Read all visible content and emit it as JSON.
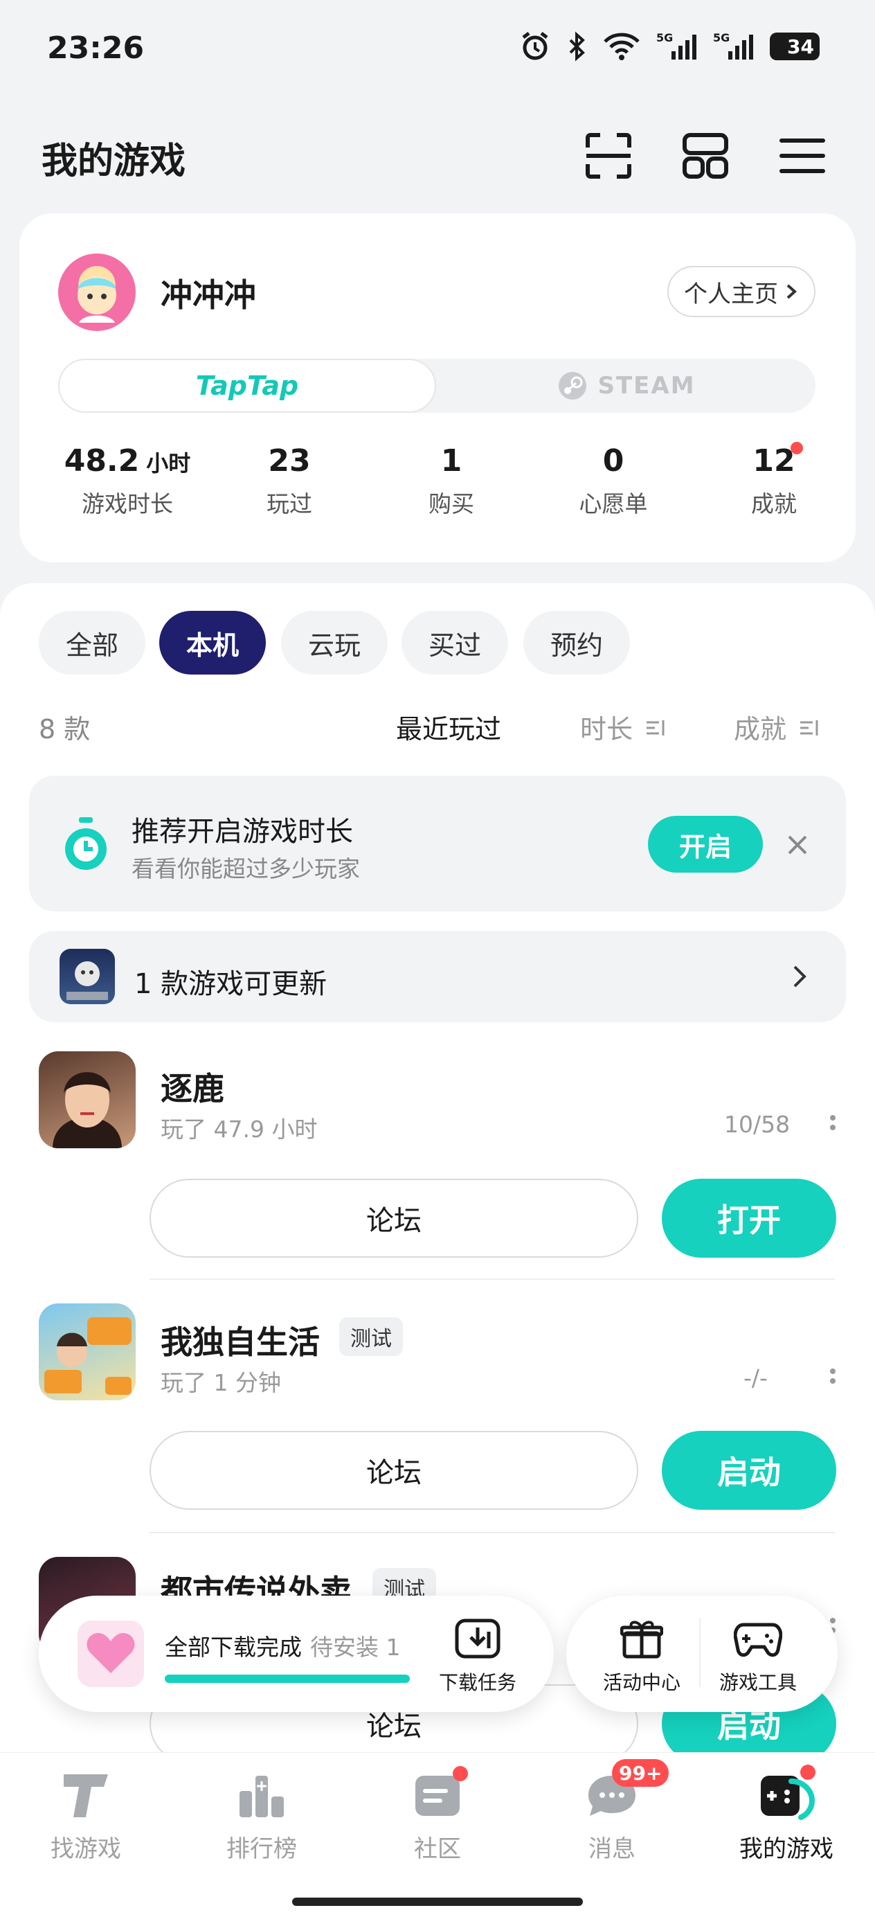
{
  "status_bar": {
    "time": "23:26",
    "battery": "34"
  },
  "header": {
    "title": "我的游戏"
  },
  "profile": {
    "name": "冲冲冲",
    "home_button": "个人主页",
    "segment_left": "TapTap",
    "segment_right": "STEAM",
    "stats": [
      {
        "value": "48.2",
        "unit": "小时",
        "label": "游戏时长"
      },
      {
        "value": "23",
        "label": "玩过"
      },
      {
        "value": "1",
        "label": "购买"
      },
      {
        "value": "0",
        "label": "心愿单"
      },
      {
        "value": "12",
        "label": "成就"
      }
    ]
  },
  "filters": {
    "chips": [
      "全部",
      "本机",
      "云玩",
      "买过",
      "预约"
    ],
    "active": "本机"
  },
  "sort": {
    "count": "8 款",
    "recent": "最近玩过",
    "duration": "时长",
    "achievement": "成就"
  },
  "recommend": {
    "title": "推荐开启游戏时长",
    "subtitle": "看看你能超过多少玩家",
    "button": "开启"
  },
  "update_bar": {
    "text": "1 款游戏可更新"
  },
  "games": [
    {
      "name": "逐鹿",
      "badge": "",
      "played": "玩了 47.9 小时",
      "progress": "10/58",
      "forum": "论坛",
      "action": "打开"
    },
    {
      "name": "我独自生活",
      "badge": "测试",
      "played": "玩了 1 分钟",
      "progress": "-/-",
      "forum": "论坛",
      "action": "启动"
    },
    {
      "name": "都市传说外卖",
      "badge": "测试",
      "played": "",
      "progress": "",
      "forum": "论坛",
      "action": "启动"
    }
  ],
  "download_bar": {
    "title": "全部下载完成",
    "pending": "待安装 1",
    "task_label": "下载任务",
    "progress": 1.0
  },
  "quick_tools": {
    "events": "活动中心",
    "tools": "游戏工具"
  },
  "tabbar": {
    "items": [
      "找游戏",
      "排行榜",
      "社区",
      "消息",
      "我的游戏"
    ],
    "message_badge": "99+"
  },
  "colors": {
    "accent": "#15D1BE",
    "chip_active": "#1F1F6E",
    "red_dot": "#FF4D4F"
  }
}
